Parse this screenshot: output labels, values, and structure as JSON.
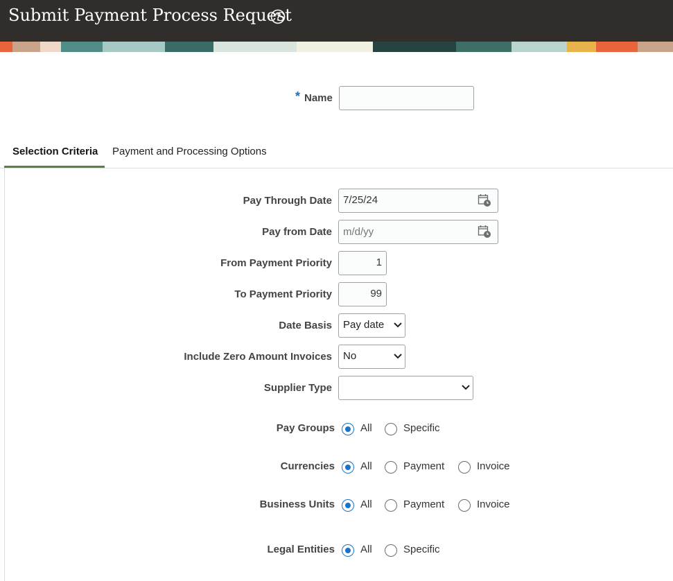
{
  "header": {
    "title": "Submit Payment Process Request"
  },
  "name_field": {
    "label": "Name",
    "required_mark": "*",
    "value": ""
  },
  "tabs": [
    {
      "label": "Selection Criteria",
      "active": true
    },
    {
      "label": "Payment and Processing Options",
      "active": false
    }
  ],
  "fields": {
    "pay_through_date": {
      "label": "Pay Through Date",
      "value": "7/25/24"
    },
    "pay_from_date": {
      "label": "Pay from Date",
      "placeholder": "m/d/yy"
    },
    "from_payment_priority": {
      "label": "From Payment Priority",
      "value": "1"
    },
    "to_payment_priority": {
      "label": "To Payment Priority",
      "value": "99"
    },
    "date_basis": {
      "label": "Date Basis",
      "value": "Pay date"
    },
    "include_zero_amount_invoices": {
      "label": "Include Zero Amount Invoices",
      "value": "No"
    },
    "supplier_type": {
      "label": "Supplier Type",
      "value": ""
    }
  },
  "radio_groups": {
    "pay_groups": {
      "label": "Pay Groups",
      "options": [
        "All",
        "Specific"
      ],
      "selected": "All"
    },
    "currencies": {
      "label": "Currencies",
      "options": [
        "All",
        "Payment",
        "Invoice"
      ],
      "selected": "All"
    },
    "business_units": {
      "label": "Business Units",
      "options": [
        "All",
        "Payment",
        "Invoice"
      ],
      "selected": "All"
    },
    "legal_entities": {
      "label": "Legal Entities",
      "options": [
        "All",
        "Specific"
      ],
      "selected": "All"
    }
  },
  "colors": {
    "header_bg": "#312d2a",
    "accent": "#1a73c7",
    "tab_underline": "#5b7f46"
  },
  "icons": [
    "help-icon",
    "calendar-icon",
    "chevron-down-icon"
  ]
}
